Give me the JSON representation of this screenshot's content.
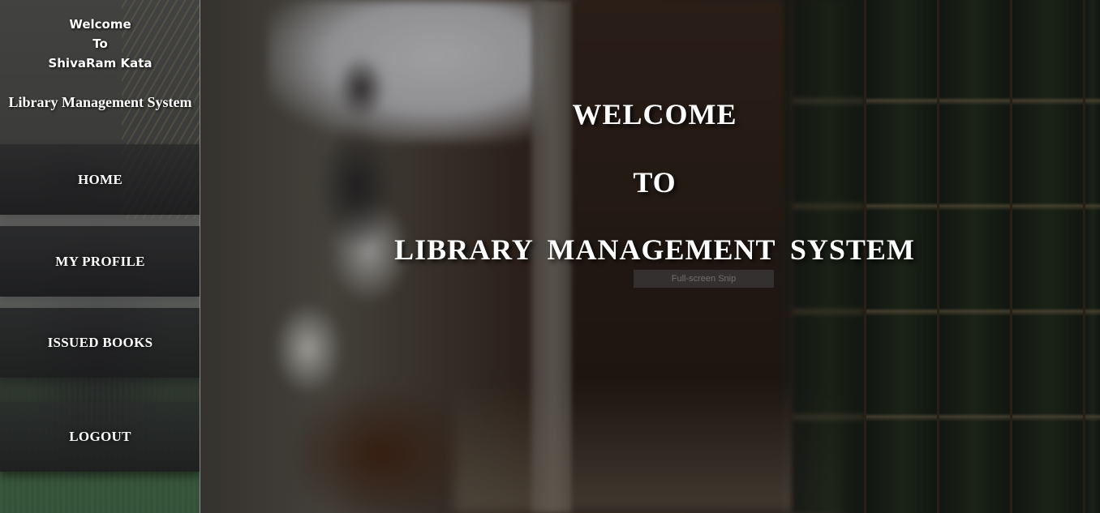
{
  "sidebar": {
    "welcome_lines": [
      "Welcome",
      "To",
      "ShivaRam Kata"
    ],
    "system_name": "Library Management System",
    "nav": {
      "home": "HOME",
      "my_profile": "MY PROFILE",
      "issued_books": "ISSUED BOOKS",
      "logout": "LOGOUT"
    }
  },
  "hero": {
    "line1": "WELCOME",
    "line2": "TO",
    "line3": "LIBRARY MANAGEMENT SYSTEM"
  },
  "tooltip": {
    "label": "Full-screen Snip"
  },
  "colors": {
    "text": "#ffffff",
    "nav_background": "#1f1f21",
    "sidebar_border": "#8c8c8c"
  }
}
